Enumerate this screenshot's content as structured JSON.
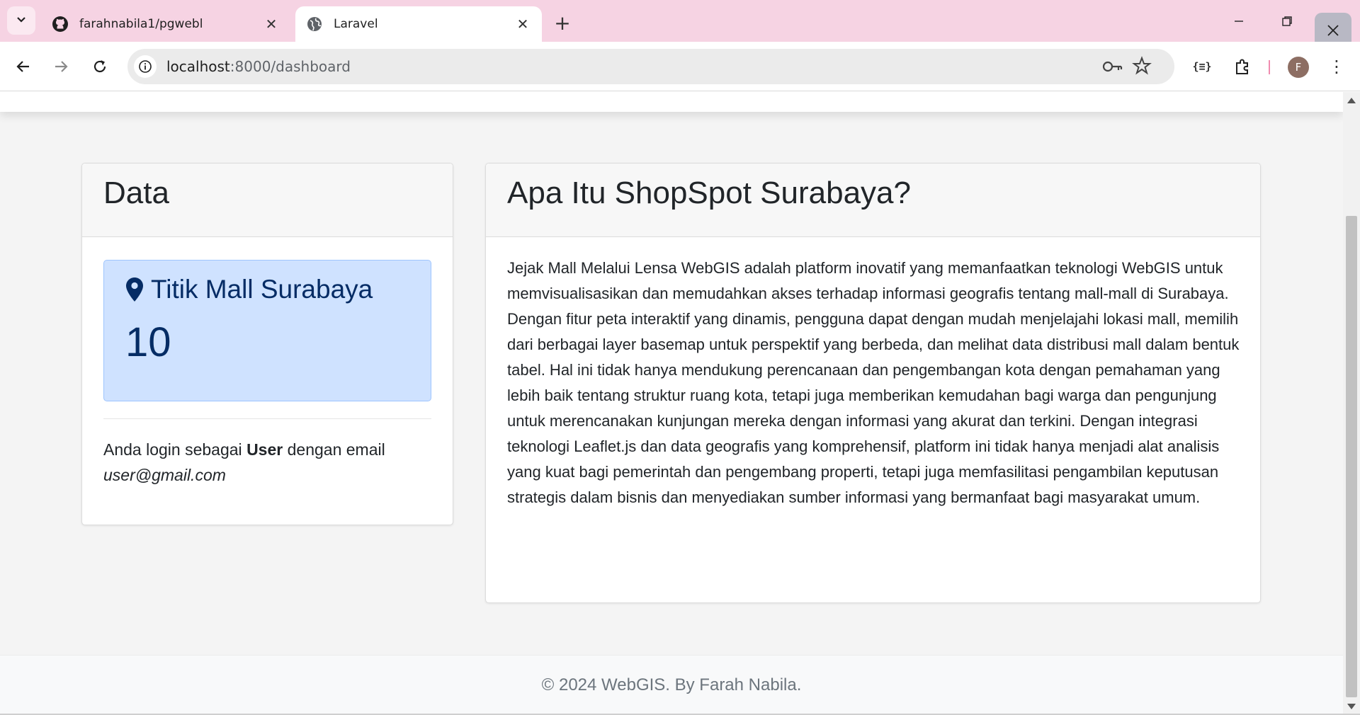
{
  "browser": {
    "tabs": [
      {
        "title": "farahnabila1/pgwebl",
        "favicon": "github-icon",
        "active": false
      },
      {
        "title": "Laravel",
        "favicon": "globe-icon",
        "active": true
      }
    ],
    "new_tab_label": "+",
    "url": {
      "host": "localhost",
      "path": ":8000/dashboard"
    },
    "json_ext_label": "{≡}",
    "profile_initial": "F",
    "colors": {
      "tabstrip": "#f6d3e3",
      "avatar": "#8d6e63"
    }
  },
  "data_card": {
    "header": "Data",
    "stat": {
      "label": "Titik Mall Surabaya",
      "value": "10",
      "icon": "map-marker-icon"
    },
    "login": {
      "prefix": "Anda login sebagai",
      "role": "User",
      "middle": "dengan email",
      "email": "user@gmail.com"
    }
  },
  "about_card": {
    "header": "Apa Itu ShopSpot Surabaya?",
    "body": "Jejak Mall Melalui Lensa WebGIS adalah platform inovatif yang memanfaatkan teknologi WebGIS untuk memvisualisasikan dan memudahkan akses terhadap informasi geografis tentang mall-mall di Surabaya. Dengan fitur peta interaktif yang dinamis, pengguna dapat dengan mudah menjelajahi lokasi mall, memilih dari berbagai layer basemap untuk perspektif yang berbeda, dan melihat data distribusi mall dalam bentuk tabel. Hal ini tidak hanya mendukung perencanaan dan pengembangan kota dengan pemahaman yang lebih baik tentang struktur ruang kota, tetapi juga memberikan kemudahan bagi warga dan pengunjung untuk merencanakan kunjungan mereka dengan informasi yang akurat dan terkini. Dengan integrasi teknologi Leaflet.js dan data geografis yang komprehensif, platform ini tidak hanya menjadi alat analisis yang kuat bagi pemerintah dan pengembang properti, tetapi juga memfasilitasi pengambilan keputusan strategis dalam bisnis dan menyediakan sumber informasi yang bermanfaat bagi masyarakat umum."
  },
  "footer": {
    "text": "© 2024 WebGIS. By Farah Nabila."
  }
}
